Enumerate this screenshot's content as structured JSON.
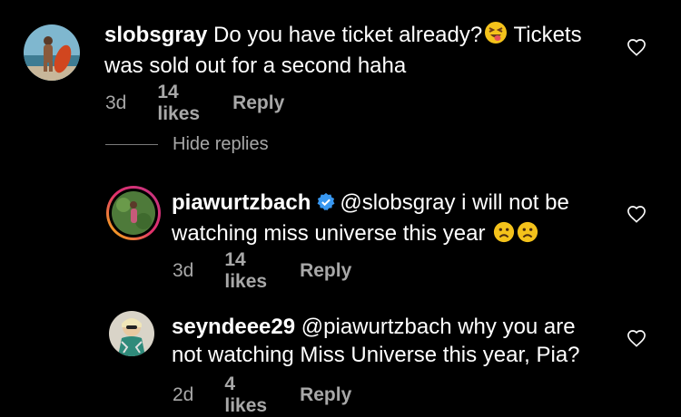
{
  "comments": [
    {
      "username": "slobsgray",
      "body_1": " Do you have ticket already?",
      "body_2": " Tickets",
      "body_line2": "was sold out for a second haha",
      "emoji": "squinting-tongue-emoji",
      "time": "3d",
      "likes": "14 likes",
      "reply": "Reply"
    },
    {
      "username": "piawurtzbach",
      "verified_icon": "verified-badge-icon",
      "body_1": "@slobsgray i will not be",
      "body_line2": "watching miss universe this year ",
      "emoji": "frowning-face-emoji",
      "time": "3d",
      "likes": "14 likes",
      "reply": "Reply"
    },
    {
      "username": "seyndeee29",
      "body_1": " @piawurtzbach why you are",
      "body_line2": "not watching Miss Universe this year, Pia?",
      "time": "2d",
      "likes": "4 likes",
      "reply": "Reply"
    }
  ],
  "hide_replies": "Hide replies",
  "colors": {
    "background": "#000000",
    "text": "#ffffff",
    "secondary_text": "#a8a8a8",
    "verified_blue": "#3897f0"
  }
}
